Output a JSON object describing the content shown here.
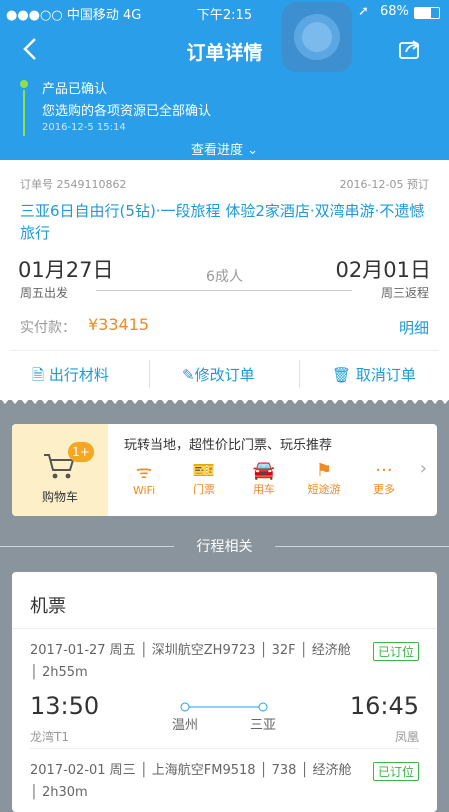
{
  "status_bar": {
    "left": "●●●○○ 中国移动  4G",
    "time": "下午2:15",
    "battery": "68%"
  },
  "nav": {
    "title": "订单详情",
    "back_icon": "back-chevron-icon",
    "share_icon": "share-icon"
  },
  "progress": {
    "status": "产品已确认",
    "message": "您选购的各项资源已全部确认",
    "timestamp": "2016-12-5 15:14",
    "view_progress": "查看进度"
  },
  "order": {
    "number_label": "订单号 2549110862",
    "booked": "2016-12-05 预订",
    "title": "三亚6日自由行(5钻)·一段旅程 体验2家酒店·双湾串游·不遗憾旅行",
    "depart_date": "01月27日",
    "depart_sub": "周五出发",
    "pax": "6成人",
    "return_date": "02月01日",
    "return_sub": "周三返程",
    "paid_label": "实付款：",
    "paid_amount": "¥33415",
    "detail_link": "明细"
  },
  "actions": {
    "materials": "出行材料",
    "modify": "修改订单",
    "cancel": "取消订单"
  },
  "promo": {
    "cart_label": "购物车",
    "cart_badge": "1+",
    "headline": "玩转当地，超性价比门票、玩乐推荐",
    "items": [
      {
        "label": "WiFi",
        "icon": "wifi-icon"
      },
      {
        "label": "门票",
        "icon": "ticket-icon"
      },
      {
        "label": "用车",
        "icon": "car-icon"
      },
      {
        "label": "短途游",
        "icon": "flag-icon"
      },
      {
        "label": "更多",
        "icon": "more-icon"
      }
    ],
    "accent": "#f08a24"
  },
  "section": {
    "title": "行程相关"
  },
  "flights": {
    "title": "机票",
    "legs": [
      {
        "info": "2017-01-27 周五 │ 深圳航空ZH9723 │ 32F │ 经济舱 │ 2h55m",
        "status": "已订位",
        "dep_time": "13:50",
        "arr_time": "16:45",
        "from": "温州",
        "to": "三亚",
        "dep_terminal": "龙湾T1",
        "arr_terminal": "凤凰"
      },
      {
        "info": "2017-02-01 周三 │ 上海航空FM9518 │ 738 │ 经济舱 │ 2h30m",
        "status": "已订位"
      }
    ]
  }
}
